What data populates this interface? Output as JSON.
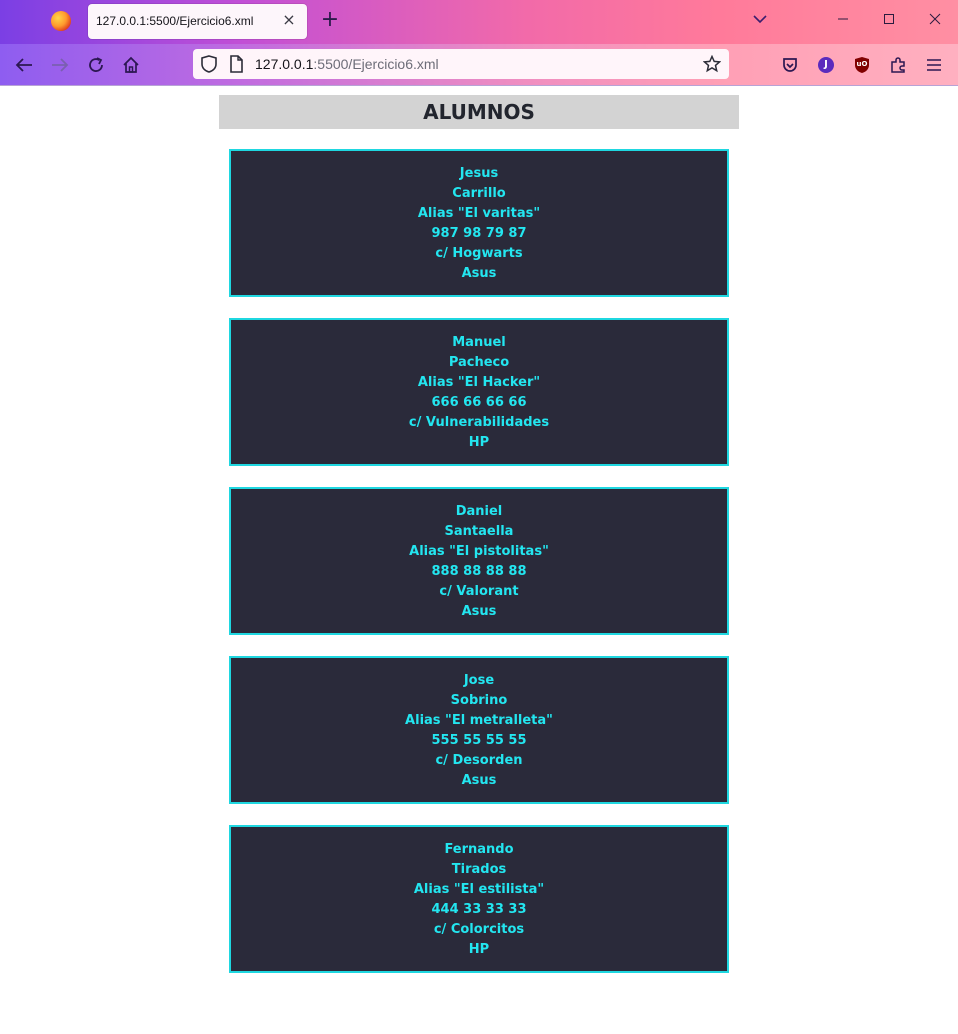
{
  "browser": {
    "tab_title": "127.0.0.1:5500/Ejercicio6.xml",
    "url_host": "127.0.0.1",
    "url_path": ":5500/Ejercicio6.xml",
    "account_initial": "J",
    "ublock_label": "uO"
  },
  "page": {
    "title": "ALUMNOS",
    "students": [
      {
        "first_name": "Jesus",
        "last_name": "Carrillo",
        "alias": "Alias \"El varitas\"",
        "phone": "987 98 79 87",
        "address": "c/ Hogwarts",
        "brand": "Asus"
      },
      {
        "first_name": "Manuel",
        "last_name": "Pacheco",
        "alias": "Alias \"El Hacker\"",
        "phone": "666 66 66 66",
        "address": "c/ Vulnerabilidades",
        "brand": "HP"
      },
      {
        "first_name": "Daniel",
        "last_name": "Santaella",
        "alias": "Alias \"El pistolitas\"",
        "phone": "888 88 88 88",
        "address": "c/ Valorant",
        "brand": "Asus"
      },
      {
        "first_name": "Jose",
        "last_name": "Sobrino",
        "alias": "Alias \"El metralleta\"",
        "phone": "555 55 55 55",
        "address": "c/ Desorden",
        "brand": "Asus"
      },
      {
        "first_name": "Fernando",
        "last_name": "Tirados",
        "alias": "Alias \"El estilista\"",
        "phone": "444 33 33 33",
        "address": "c/ Colorcitos",
        "brand": "HP"
      }
    ]
  },
  "colors": {
    "card_background": "#2a2a3a",
    "card_text": "#23e6f0",
    "card_border": "#1fd7e0",
    "header_background": "#d3d3d3"
  }
}
